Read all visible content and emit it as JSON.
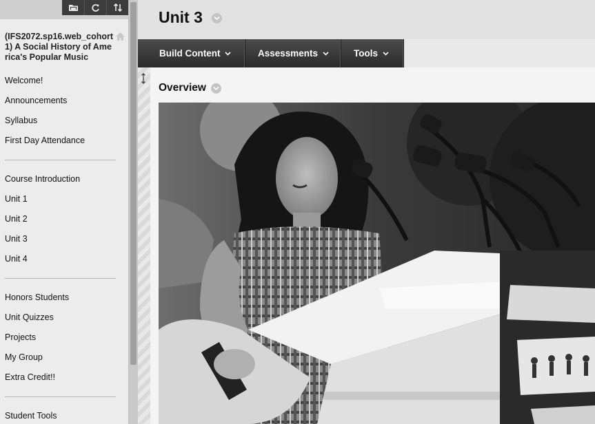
{
  "sidebar": {
    "course_title": "(IFS2072.sp16.web_cohort1) A Social History of America's Popular Music",
    "toolbar_icons": [
      "folder-icon",
      "refresh-icon",
      "sort-icon"
    ],
    "sections": [
      [
        "Welcome!",
        "Announcements",
        "Syllabus",
        "First Day Attendance"
      ],
      [
        "Course Introduction",
        "Unit 1",
        "Unit 2",
        "Unit 3",
        "Unit 4"
      ],
      [
        "Honors Students",
        "Unit Quizzes",
        "Projects",
        "My Group",
        "Extra Credit!!"
      ],
      [
        "Student Tools"
      ]
    ]
  },
  "page": {
    "title": "Unit 3",
    "action_bar": {
      "build_content": "Build Content",
      "assessments": "Assessments",
      "tools": "Tools"
    },
    "content": {
      "item_title": "Overview"
    }
  },
  "colors": {
    "action_bar": "#3a3a3a",
    "sidebar_bg": "#ececec",
    "header_bg": "#e2e2e2"
  }
}
